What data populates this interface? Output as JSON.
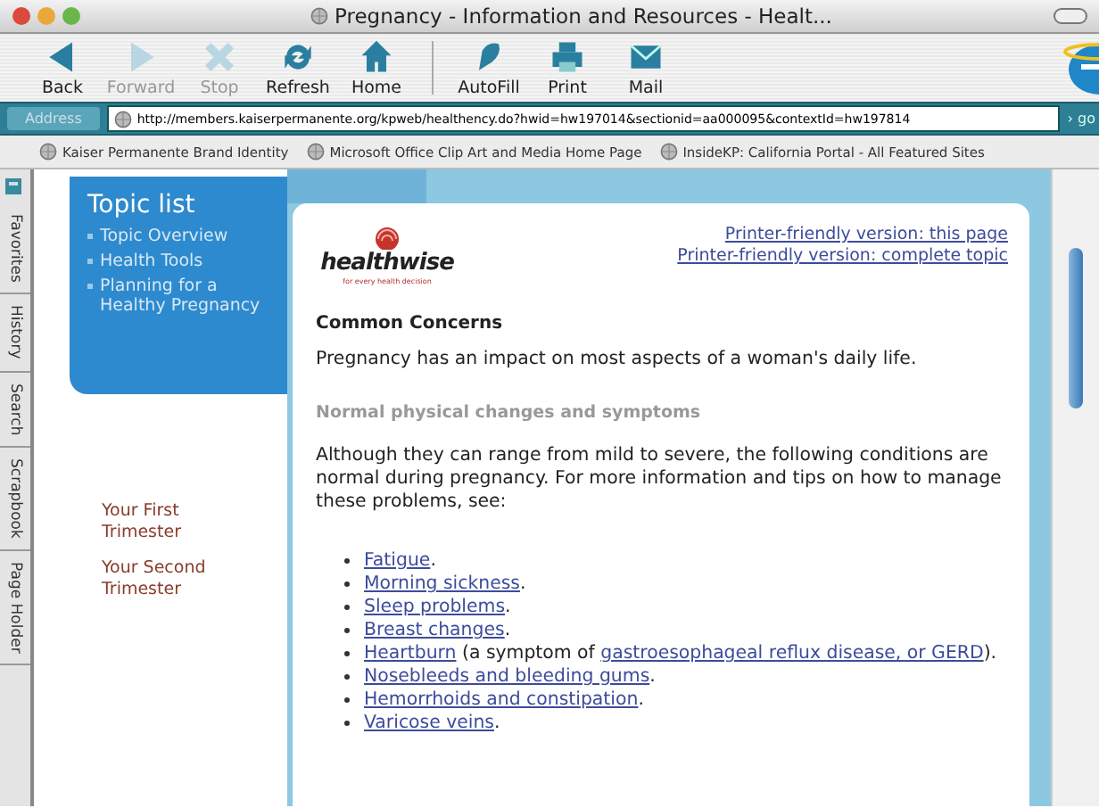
{
  "window": {
    "title": "Pregnancy - Information and Resources - Healt..."
  },
  "toolbar": [
    {
      "kind": "back",
      "label": "Back",
      "disabled": false
    },
    {
      "kind": "forward",
      "label": "Forward",
      "disabled": true
    },
    {
      "kind": "stop",
      "label": "Stop",
      "disabled": true
    },
    {
      "kind": "refresh",
      "label": "Refresh",
      "disabled": false
    },
    {
      "kind": "home",
      "label": "Home",
      "disabled": false
    },
    {
      "kind": "autofill",
      "label": "AutoFill",
      "disabled": false
    },
    {
      "kind": "print",
      "label": "Print",
      "disabled": false
    },
    {
      "kind": "mail",
      "label": "Mail",
      "disabled": false
    }
  ],
  "address": {
    "label": "Address",
    "value": "http://members.kaiserpermanente.org/kpweb/healthency.do?hwid=hw197014&sectionid=aa000095&contextId=hw197814",
    "go": "› go"
  },
  "favorites": [
    "Kaiser Permanente Brand Identity",
    "Microsoft Office Clip Art and Media Home Page",
    "InsideKP: California Portal - All Featured Sites"
  ],
  "explorer_tabs": [
    "Favorites",
    "History",
    "Search",
    "Scrapbook",
    "Page Holder"
  ],
  "topic_list": {
    "title": "Topic list",
    "items": [
      "Topic Overview",
      "Health Tools",
      "Planning for a Healthy Pregnancy"
    ]
  },
  "trimester_links": [
    "Your First Trimester",
    "Your Second Trimester"
  ],
  "logo": {
    "name": "healthwise",
    "tagline": "for every health decision"
  },
  "printer_links": [
    "Printer-friendly version: this page",
    "Printer-friendly version: complete topic"
  ],
  "article": {
    "heading": "Common Concerns",
    "intro": "Pregnancy has an impact on most aspects of a woman's daily life.",
    "subheading": "Normal physical changes and symptoms",
    "lead": "Although they can range from mild to severe, the following conditions are normal during pregnancy. For more information and tips on how to manage these problems, see:",
    "items": [
      [
        {
          "text": "Fatigue",
          "link": true
        },
        {
          "text": ".",
          "link": false
        }
      ],
      [
        {
          "text": "Morning sickness",
          "link": true
        },
        {
          "text": ".",
          "link": false
        }
      ],
      [
        {
          "text": "Sleep problems",
          "link": true
        },
        {
          "text": ".",
          "link": false
        }
      ],
      [
        {
          "text": "Breast changes",
          "link": true
        },
        {
          "text": ".",
          "link": false
        }
      ],
      [
        {
          "text": "Heartburn",
          "link": true
        },
        {
          "text": " (a symptom of ",
          "link": false
        },
        {
          "text": "gastroesophageal reflux disease, or GERD",
          "link": true
        },
        {
          "text": ").",
          "link": false
        }
      ],
      [
        {
          "text": "Nosebleeds and bleeding gums",
          "link": true
        },
        {
          "text": ".",
          "link": false
        }
      ],
      [
        {
          "text": "Hemorrhoids and constipation",
          "link": true
        },
        {
          "text": ".",
          "link": false
        }
      ],
      [
        {
          "text": "Varicose veins",
          "link": true
        },
        {
          "text": ".",
          "link": false
        }
      ]
    ]
  }
}
